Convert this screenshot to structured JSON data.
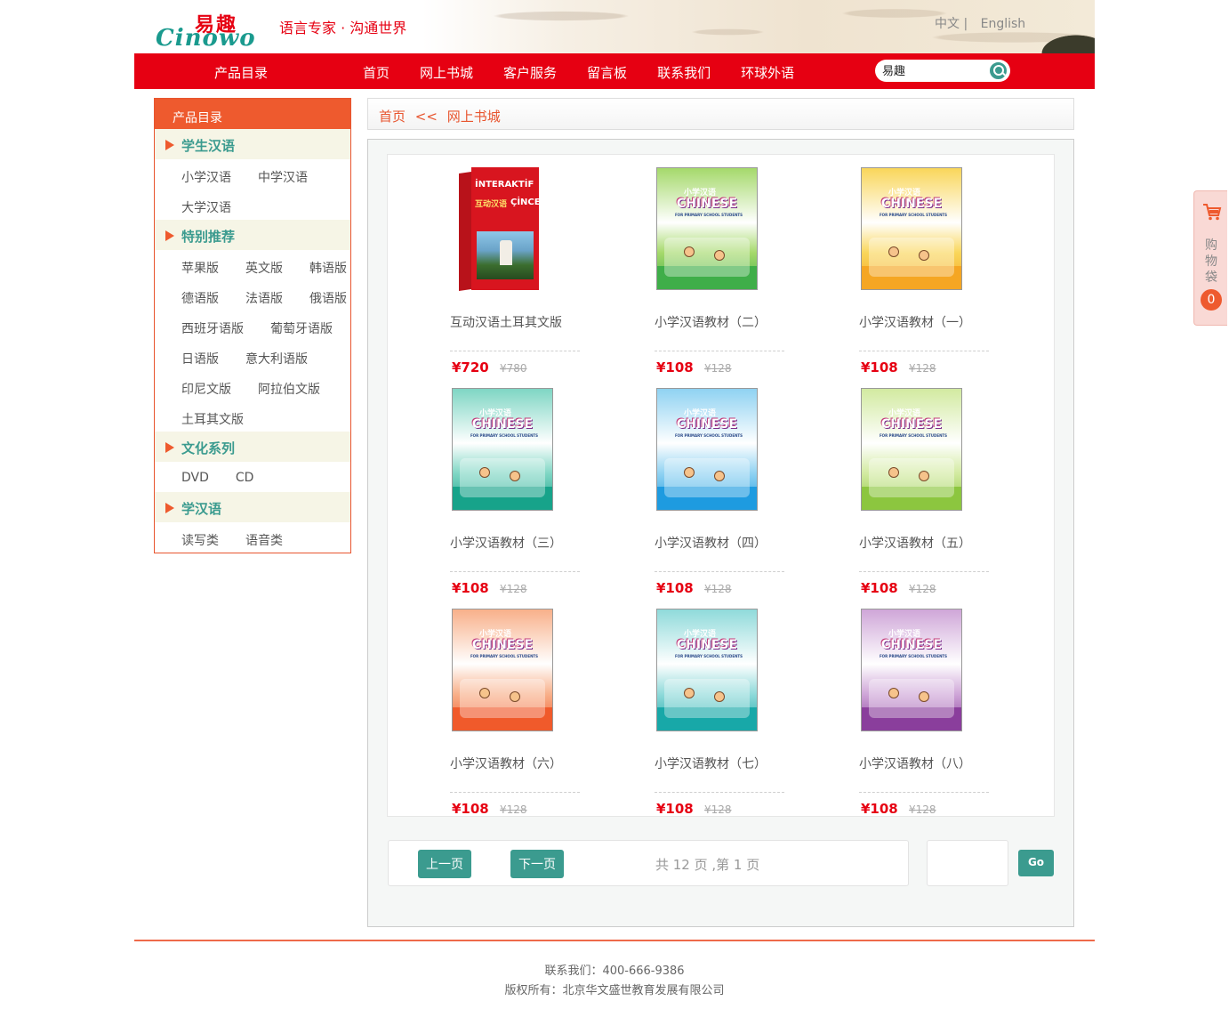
{
  "header": {
    "logo_cn": "易趣",
    "logo_en": "Cinowo",
    "slogan": "语言专家 · 沟通世界",
    "lang_cn": "中文 |",
    "lang_en": "English"
  },
  "nav": {
    "catalog": "产品目录",
    "items": [
      "首页",
      "网上书城",
      "客户服务",
      "留言板",
      "联系我们",
      "环球外语"
    ],
    "search_value": "易趣"
  },
  "sidebar": {
    "title": "产品目录",
    "categories": [
      {
        "title": "学生汉语",
        "rows": [
          [
            "小学汉语",
            "中学汉语"
          ],
          [
            "大学汉语"
          ]
        ]
      },
      {
        "title": "特别推荐",
        "rows": [
          [
            "苹果版",
            "英文版",
            "韩语版"
          ],
          [
            "德语版",
            "法语版",
            "俄语版"
          ],
          [
            "西班牙语版",
            "葡萄牙语版"
          ],
          [
            "日语版",
            "意大利语版"
          ],
          [
            "印尼文版",
            "阿拉伯文版"
          ],
          [
            "土耳其文版"
          ]
        ]
      },
      {
        "title": "文化系列",
        "rows": [
          [
            "DVD",
            "CD"
          ]
        ]
      },
      {
        "title": "学汉语",
        "rows": [
          [
            "读写类",
            "语音类"
          ]
        ]
      }
    ]
  },
  "breadcrumb": {
    "home": "首页",
    "sep": "<<",
    "current": "网上书城"
  },
  "products": [
    {
      "name": "互动汉语土耳其文版",
      "price": "¥720",
      "old_price": "¥780",
      "cover": "box",
      "color1": "#d8151f",
      "color2": "#b8121a"
    },
    {
      "name": "小学汉语教材（二）",
      "price": "¥108",
      "old_price": "¥128",
      "cover": "book",
      "color1": "#3fae49",
      "color2": "#a5d96b"
    },
    {
      "name": "小学汉语教材（一）",
      "price": "¥108",
      "old_price": "¥128",
      "cover": "book",
      "color1": "#f5a623",
      "color2": "#f9d65a"
    },
    {
      "name": "小学汉语教材（三）",
      "price": "¥108",
      "old_price": "¥128",
      "cover": "book",
      "color1": "#17a38a",
      "color2": "#7fd6c4"
    },
    {
      "name": "小学汉语教材（四）",
      "price": "¥108",
      "old_price": "¥128",
      "cover": "book",
      "color1": "#1e9be0",
      "color2": "#8fd2f2"
    },
    {
      "name": "小学汉语教材（五）",
      "price": "¥108",
      "old_price": "¥128",
      "cover": "book",
      "color1": "#8cc63f",
      "color2": "#d2eaa0"
    },
    {
      "name": "小学汉语教材（六）",
      "price": "¥108",
      "old_price": "¥128",
      "cover": "book",
      "color1": "#f05a2b",
      "color2": "#f8b08a"
    },
    {
      "name": "小学汉语教材（七）",
      "price": "¥108",
      "old_price": "¥128",
      "cover": "book",
      "color1": "#18a8a8",
      "color2": "#8fdada"
    },
    {
      "name": "小学汉语教材（八）",
      "price": "¥108",
      "old_price": "¥128",
      "cover": "book",
      "color1": "#8a3e9c",
      "color2": "#cfa6d8"
    }
  ],
  "cover_text": {
    "book_small_title": "小学汉语",
    "book_title": "CHINESE",
    "book_subtitle": "FOR PRIMARY SCHOOL STUDENTS",
    "box_title": "İNTERAKTİF",
    "box_cn": "互动汉语",
    "box_sub": "ÇİNCE"
  },
  "pager": {
    "prev": "上一页",
    "next": "下一页",
    "info": "共  12  页 ,第 1 页",
    "go": "Go",
    "page_input": ""
  },
  "footer": {
    "contact": "联系我们：400-666-9386",
    "copyright": "版权所有：北京华文盛世教育发展有限公司"
  },
  "cart": {
    "label": "购物袋",
    "count": "0"
  },
  "colors": {
    "brand_red": "#e60012",
    "accent_orange": "#ee5a2e",
    "teal": "#3b9b8f"
  }
}
